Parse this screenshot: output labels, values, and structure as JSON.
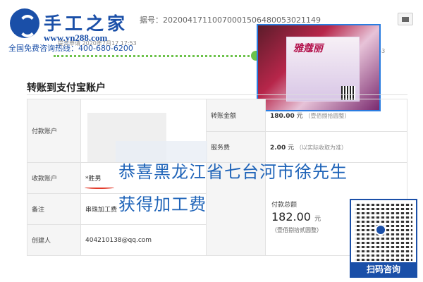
{
  "header": {
    "site_title": "手工之家",
    "site_url": "www.yn288.com",
    "hotline": "全国免费咨询热线：400-680-6200",
    "order_number": "据号：20200417110070001506480053021149",
    "progress_step_left": "提交申请 2020年7月17 17:53",
    "progress_step_right": "53"
  },
  "popup": {
    "brand": "雅蔻丽"
  },
  "section": {
    "title": "转账到支付宝账户"
  },
  "table": {
    "payer_label": "付款账户",
    "receiver_label": "收款账户",
    "receiver_value": "*胜男",
    "remark_label": "备注",
    "remark_value": "串珠加工费",
    "creator_label": "创建人",
    "creator_value": "404210138@qq.com",
    "transfer_amount_label": "转账金额",
    "transfer_amount_value": "180.00",
    "transfer_amount_unit": "元",
    "transfer_amount_note": "（壹佰捌拾圆整）",
    "fee_label": "服务费",
    "fee_value": "2.00",
    "fee_unit": "元",
    "fee_note": "（以实际收取为准）",
    "total_label": "付款总额",
    "total_value": "182.00",
    "total_unit": "元",
    "total_note": "（壹佰捌拾贰圆整）"
  },
  "overlay": {
    "line1": "恭喜黑龙江省七台河市徐先生",
    "line2": "获得加工费"
  },
  "qr": {
    "label": "扫码咨询"
  },
  "colors": {
    "brand_blue": "#1a4fa8",
    "overlay_blue": "#1e63b8",
    "progress_green": "#6cc24a",
    "underline_red": "#e23a2a"
  }
}
